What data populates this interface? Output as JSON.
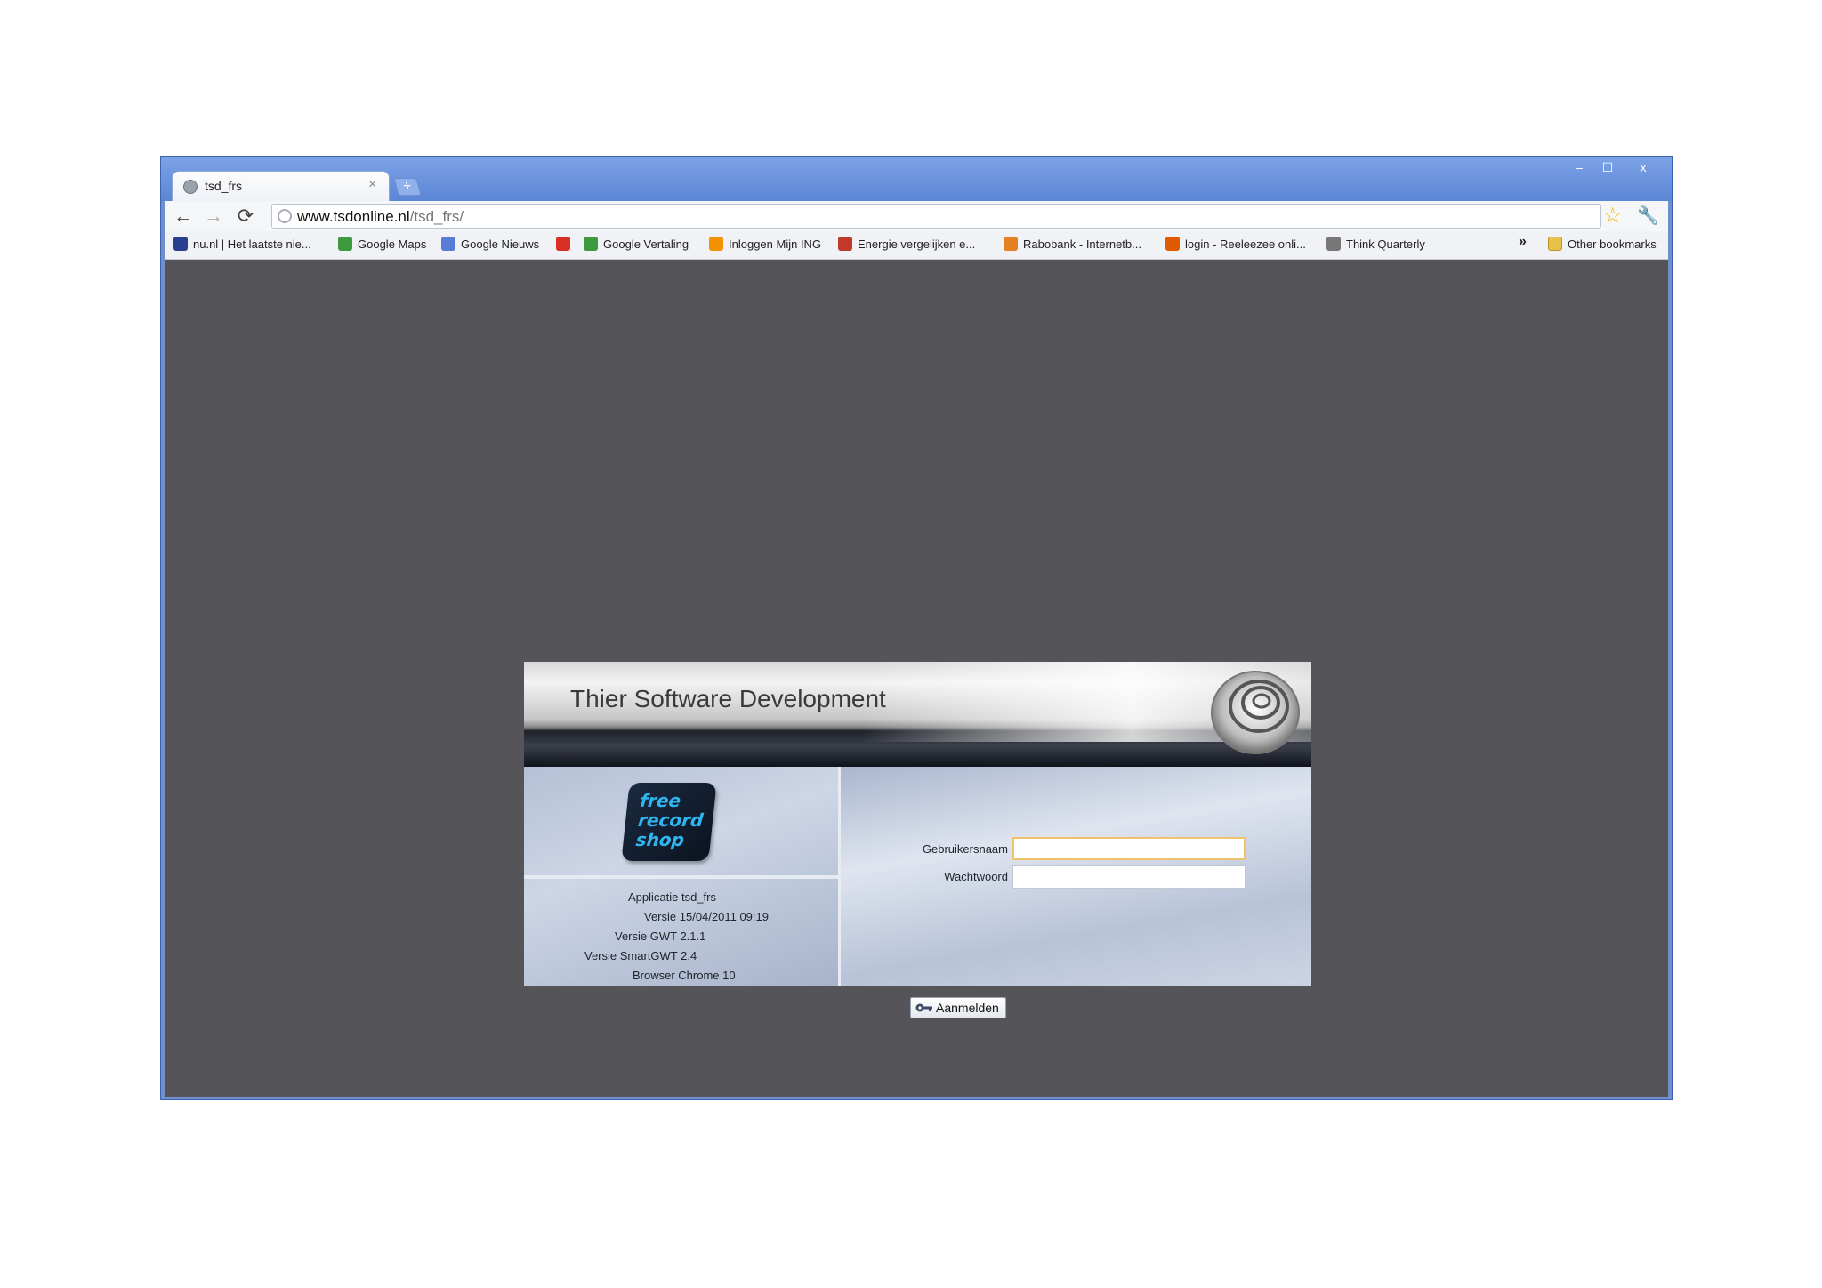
{
  "browser": {
    "tab_title": "tsd_frs",
    "tab_close": "×",
    "new_tab": "+",
    "window_controls": {
      "minimize": "–",
      "maximize": "☐",
      "close": "x"
    },
    "nav": {
      "back": "←",
      "forward": "→",
      "reload": "⟳"
    },
    "url_host": "www.tsdonline.nl",
    "url_path": "/tsd_frs/",
    "star": "☆",
    "wrench": "🔧",
    "bookmarks": [
      {
        "label": "nu.nl | Het laatste nie...",
        "color": "#2b3d8f"
      },
      {
        "label": "Google Maps",
        "color": "#3d9a3f"
      },
      {
        "label": "Google Nieuws",
        "color": "#5a7bd6"
      },
      {
        "label": "",
        "color": "#d93025"
      },
      {
        "label": "Google Vertaling",
        "color": "#3d9a3f"
      },
      {
        "label": "Inloggen Mijn ING",
        "color": "#f39200"
      },
      {
        "label": "Energie vergelijken e...",
        "color": "#c0392b"
      },
      {
        "label": "Rabobank - Internetb...",
        "color": "#e67e22"
      },
      {
        "label": "login - Reeleezee onli...",
        "color": "#e05a00"
      },
      {
        "label": "Think Quarterly",
        "color": "#777777"
      }
    ],
    "chevron": "»",
    "other_bookmarks": "Other bookmarks"
  },
  "login": {
    "banner_title": "Thier Software Development",
    "logo_lines": [
      "free",
      "record",
      "shop"
    ],
    "info": {
      "app": "Applicatie tsd_frs",
      "version": "Versie 15/04/2011 09:19",
      "gwt": "Versie GWT 2.1.1",
      "smartgwt": "Versie SmartGWT 2.4",
      "browser": "Browser Chrome 10"
    },
    "username_label": "Gebruikersnaam",
    "password_label": "Wachtwoord",
    "username_value": "",
    "password_value": "",
    "submit_label": "Aanmelden"
  }
}
